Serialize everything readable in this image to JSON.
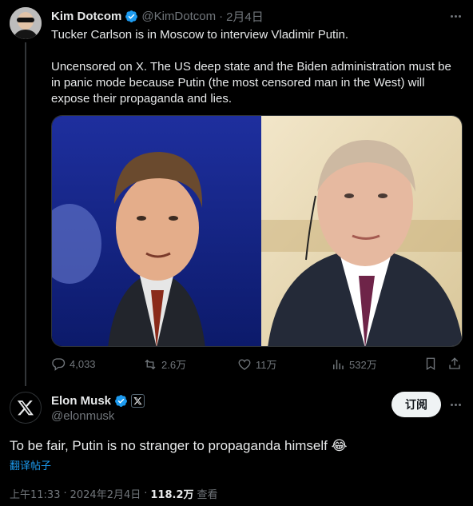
{
  "quoted_tweet": {
    "author_name": "Kim Dotcom",
    "author_handle": "@KimDotcom",
    "separator": "·",
    "date": "2月4日",
    "paragraphs": [
      "Tucker Carlson is in Moscow to interview Vladimir Putin.",
      "Uncensored on X. The US deep state and the Biden administration must be in panic mode because Putin (the most censored man in the West) will expose their propaganda and lies."
    ],
    "stats": {
      "replies": "4,033",
      "reposts": "2.6万",
      "likes": "11万",
      "views": "532万"
    }
  },
  "main_tweet": {
    "author_name": "Elon Musk",
    "author_handle": "@elonmusk",
    "subscribe_label": "订阅",
    "text": "To be fair, Putin is no stranger to propaganda himself 😂",
    "translate_label": "翻译帖子",
    "time": "上午11:33",
    "date": "2024年2月4日",
    "separator": "·",
    "views": "118.2万",
    "views_label": "查看"
  },
  "colors": {
    "background": "#000000",
    "text": "#e7e9ea",
    "secondary": "#71767b",
    "accent": "#1d9bf0",
    "verified": "#1d9bf0"
  },
  "icons": [
    "verified-icon",
    "more-icon",
    "reply-icon",
    "repost-icon",
    "like-icon",
    "views-icon",
    "bookmark-icon",
    "share-icon",
    "x-logo-icon"
  ]
}
